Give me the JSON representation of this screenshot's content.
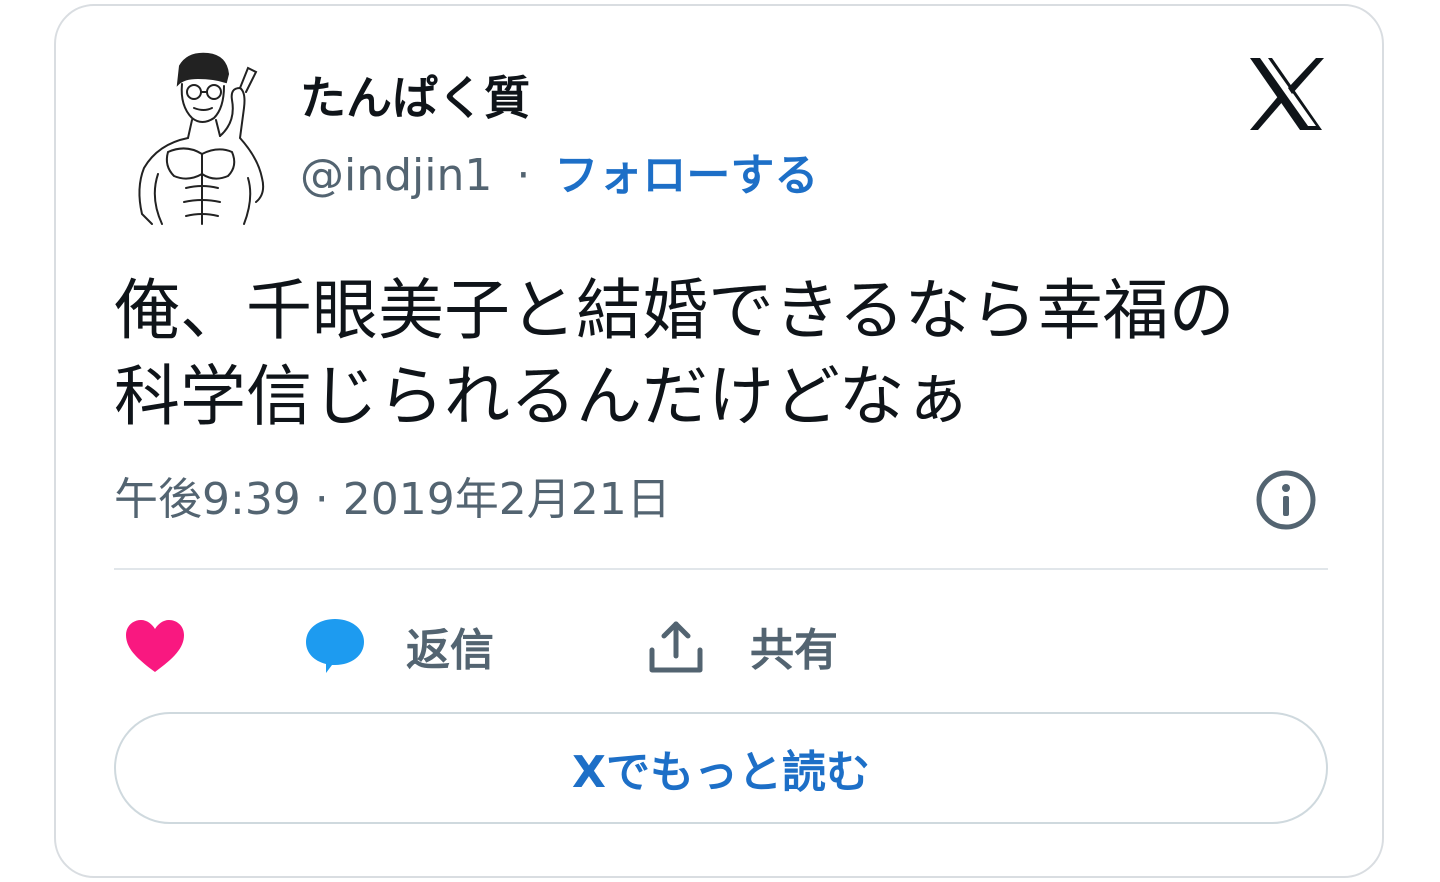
{
  "author": {
    "display_name": "たんぱく質",
    "handle": "@indjin1",
    "separator": "·",
    "follow_label": "フォローする"
  },
  "tweet": {
    "lines": [
      "俺、千眼美子と結婚できるなら幸福の",
      "科学信じられるんだけどなぁ"
    ],
    "timestamp": "午後9:39 · 2019年2月21日"
  },
  "actions": {
    "reply_label": "返信",
    "share_label": "共有"
  },
  "read_more_label": "Xでもっと読む",
  "colors": {
    "like": "#f91880",
    "reply": "#1d9bf0",
    "link": "#1d6fc7",
    "muted": "#536471",
    "text": "#0f1419"
  },
  "icons": [
    "avatar",
    "x-logo-icon",
    "info-icon",
    "heart-icon",
    "reply-bubble-icon",
    "share-icon"
  ]
}
